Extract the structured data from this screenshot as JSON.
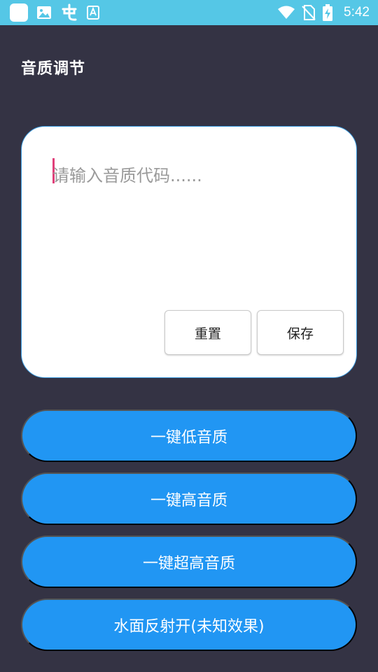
{
  "status_bar": {
    "left_icons": [
      "app-square-icon",
      "image-icon",
      "app-logo-icon",
      "keyboard-icon"
    ],
    "right_icons": [
      "wifi-icon",
      "no-sim-icon",
      "battery-charging-icon"
    ],
    "time": "5:42",
    "color": "#55c7e6"
  },
  "page": {
    "title": "音质调节",
    "background": "#343344"
  },
  "editor": {
    "placeholder": "请输入音质代码......",
    "value": "",
    "reset_label": "重置",
    "save_label": "保存"
  },
  "actions": {
    "accent": "#2196f3",
    "low_quality": "一键低音质",
    "high_quality": "一键高音质",
    "ultra_quality": "一键超高音质",
    "water_reflection": "水面反射开(未知效果)"
  }
}
